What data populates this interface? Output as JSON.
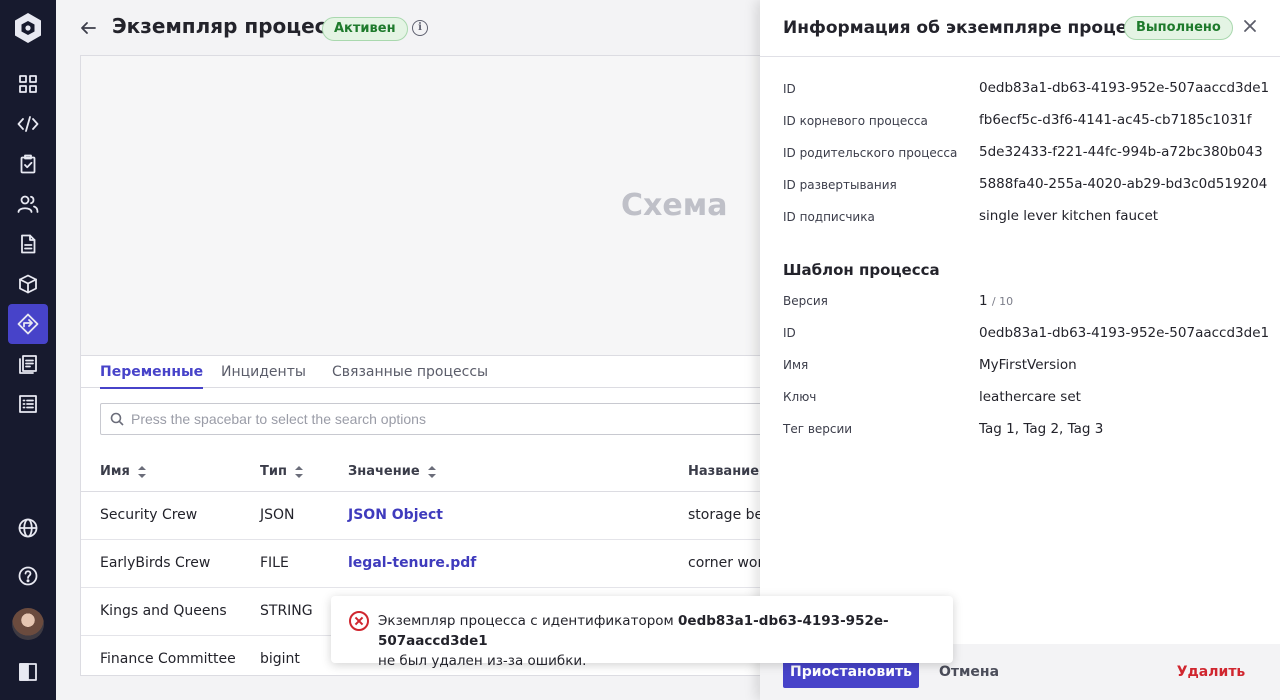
{
  "nav": {
    "items": [
      {
        "name": "dashboard-icon"
      },
      {
        "name": "code-icon"
      },
      {
        "name": "clipboard-icon"
      },
      {
        "name": "users-icon"
      },
      {
        "name": "document-icon"
      },
      {
        "name": "cube-icon"
      },
      {
        "name": "processes-icon",
        "active": true
      },
      {
        "name": "log-icon"
      },
      {
        "name": "list-icon"
      }
    ],
    "bottom": [
      "globe-icon",
      "help-icon",
      "avatar",
      "panel-toggle-icon"
    ]
  },
  "header": {
    "title": "Экземпляр процесса",
    "status": "Активен"
  },
  "diagram": {
    "label": "Схема"
  },
  "tabs": [
    "Переменные",
    "Инциденты",
    "Связанные процессы"
  ],
  "search": {
    "placeholder": "Press the spacebar to select the search options"
  },
  "table": {
    "columns": [
      "Имя",
      "Тип",
      "Значение",
      "Название д"
    ],
    "rows": [
      {
        "name": "Security Crew",
        "type": "JSON",
        "value": "JSON Object",
        "extra": "storage ber"
      },
      {
        "name": "EarlyBirds Crew",
        "type": "FILE",
        "value": "legal-tenure.pdf",
        "extra": "corner worl"
      },
      {
        "name": "Kings and Queens",
        "type": "STRING",
        "value": "",
        "extra": ""
      },
      {
        "name": "Finance Committee",
        "type": "bigint",
        "value": "",
        "extra": ""
      }
    ]
  },
  "panel": {
    "title": "Информация об экземпляре процесса",
    "status": "Выполнено",
    "fields": [
      {
        "label": "ID",
        "value": "0edb83a1-db63-4193-952e-507aaccd3de1"
      },
      {
        "label": "ID корневого процесса",
        "value": "fb6ecf5c-d3f6-4141-ac45-cb7185c1031f"
      },
      {
        "label": "ID родительского процесса",
        "value": "5de32433-f221-44fc-994b-a72bc380b043"
      },
      {
        "label": "ID развертывания",
        "value": "5888fa40-255a-4020-ab29-bd3c0d519204"
      },
      {
        "label": "ID подписчика",
        "value": "single lever kitchen faucet"
      }
    ],
    "template_title": "Шаблон процесса",
    "template": {
      "version_label": "Версия",
      "version": "1",
      "version_total": "/ 10",
      "fields": [
        {
          "label": "ID",
          "value": "0edb83a1-db63-4193-952e-507aaccd3de1"
        },
        {
          "label": "Имя",
          "value": "MyFirstVersion"
        },
        {
          "label": "Ключ",
          "value": "leathercare set"
        },
        {
          "label": "Тег версии",
          "value": "Tag 1, Tag 2, Tag 3"
        }
      ]
    },
    "buttons": {
      "suspend": "Приостановить",
      "cancel": "Отмена",
      "delete": "Удалить"
    }
  },
  "toast": {
    "prefix": "Экземпляр процесса с идентификатором",
    "id": "0edb83a1-db63-4193-952e-507aaccd3de1",
    "suffix": "не был удален из-за ошибки."
  },
  "colors": {
    "accent": "#4743c9",
    "rail": "#171a2e",
    "success": "#1e7a2c",
    "danger": "#d0262f"
  }
}
